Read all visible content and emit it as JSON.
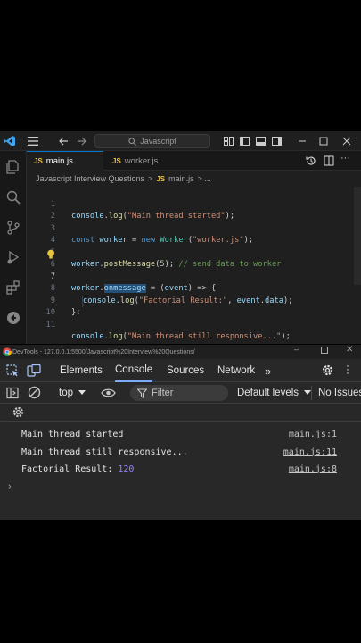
{
  "vscode": {
    "search_placeholder": "Javascript",
    "tabs": [
      {
        "icon": "JS",
        "label": "main.js"
      },
      {
        "icon": "JS",
        "label": "worker.js"
      }
    ],
    "breadcrumb": {
      "folder": "Javascript Interview Questions",
      "sep": ">",
      "file_icon": "JS",
      "file": "main.js",
      "tail": "> ..."
    },
    "line_numbers": [
      "1",
      "2",
      "3",
      "4",
      "5",
      "6",
      "7",
      "8",
      "9",
      "10",
      "11"
    ],
    "code": {
      "l1": {
        "fn_obj": "console",
        "dot": ".",
        "fn": "log",
        "open": "(",
        "str": "\"Main thread started\"",
        "close": ");"
      },
      "l3": {
        "kw": "const",
        "var": " worker",
        "eq": " = ",
        "new": "new",
        "cls": " Worker",
        "open": "(",
        "str": "\"worker.js\"",
        "close": ");"
      },
      "l5": {
        "obj": "worker",
        "dot": ".",
        "fn": "postMessage",
        "open": "(",
        "num": "5",
        "close": ");",
        "comment": " // send data to worker"
      },
      "l7": {
        "obj": "worker",
        "dot": ".",
        "prop": "onmessage",
        "eq": " = ",
        "open": "(",
        "param": "event",
        "arrow": ") => {"
      },
      "l8": {
        "fn_obj": "console",
        "dot": ".",
        "fn": "log",
        "open": "(",
        "str": "\"Factorial Result:\"",
        "comma": ", ",
        "obj": "event",
        "dot2": ".",
        "prop": "data",
        "close": ");"
      },
      "l9": {
        "text": "};"
      },
      "l11": {
        "fn_obj": "console",
        "dot": ".",
        "fn": "log",
        "open": "(",
        "str": "\"Main thread still responsive...\"",
        "close": ");"
      }
    }
  },
  "devtools": {
    "title": "DevTools - 127.0.0.1:5500/Javascript%20Interview%20Questions/",
    "tabs": [
      "Elements",
      "Console",
      "Sources",
      "Network"
    ],
    "more_tabs": "»",
    "context": "top",
    "filter_placeholder": "Filter",
    "levels": "Default levels",
    "issues": "No Issues",
    "messages": [
      {
        "text": "Main thread started",
        "source": "main.js:1"
      },
      {
        "text": "Main thread still responsive...",
        "source": "main.js:11"
      },
      {
        "text_prefix": "Factorial Result: ",
        "value": "120",
        "source": "main.js:8"
      }
    ],
    "prompt": "›"
  }
}
